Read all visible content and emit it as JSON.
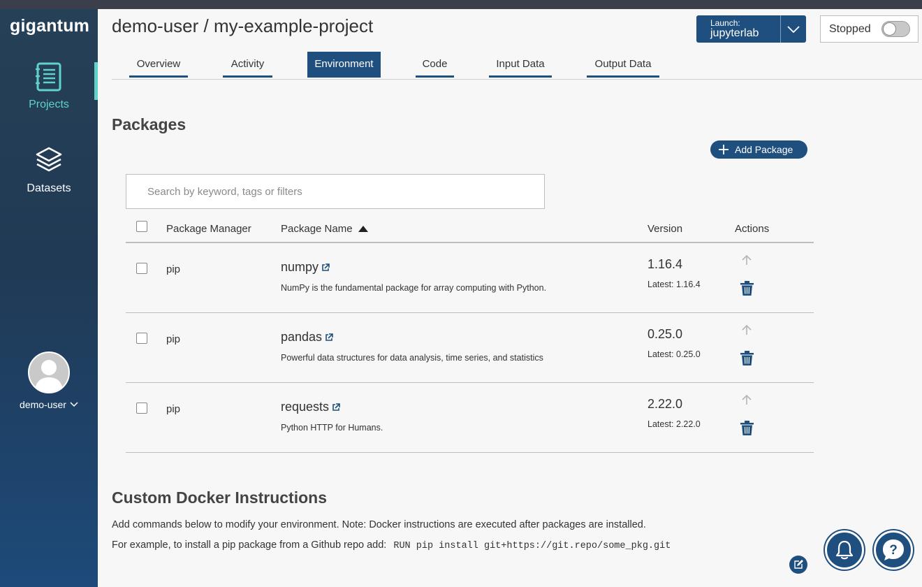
{
  "app": {
    "logo": "gigantum"
  },
  "sidebar": {
    "items": [
      {
        "label": "Projects",
        "icon": "notebook-icon",
        "active": true
      },
      {
        "label": "Datasets",
        "icon": "layers-icon",
        "active": false
      }
    ],
    "user": {
      "name": "demo-user"
    },
    "active_color": "#60d2c9"
  },
  "header": {
    "project_title": "demo-user / my-example-project",
    "launch": {
      "caption": "Launch:",
      "tool": "jupyterlab"
    },
    "status": {
      "label": "Stopped",
      "running": false
    }
  },
  "tabs": [
    {
      "label": "Overview",
      "active": false
    },
    {
      "label": "Activity",
      "active": false
    },
    {
      "label": "Environment",
      "active": true
    },
    {
      "label": "Code",
      "active": false
    },
    {
      "label": "Input Data",
      "active": false
    },
    {
      "label": "Output Data",
      "active": false
    }
  ],
  "packages": {
    "heading": "Packages",
    "add_button": "Add Package",
    "search_placeholder": "Search by keyword, tags or filters",
    "columns": {
      "manager": "Package Manager",
      "name": "Package Name",
      "version": "Version",
      "actions": "Actions"
    },
    "rows": [
      {
        "manager": "pip",
        "name": "numpy",
        "description": "NumPy is the fundamental package for array computing with Python.",
        "version": "1.16.4",
        "latest": "Latest: 1.16.4"
      },
      {
        "manager": "pip",
        "name": "pandas",
        "description": "Powerful data structures for data analysis, time series, and statistics",
        "version": "0.25.0",
        "latest": "Latest: 0.25.0"
      },
      {
        "manager": "pip",
        "name": "requests",
        "description": "Python HTTP for Humans.",
        "version": "2.22.0",
        "latest": "Latest: 2.22.0"
      }
    ]
  },
  "docker": {
    "heading": "Custom Docker Instructions",
    "line1": "Add commands below to modify your environment. Note: Docker instructions are executed after packages are installed.",
    "line2": "For example, to install a pip package from a Github repo add:",
    "code": "RUN pip install git+https://git.repo/some_pkg.git"
  },
  "colors": {
    "primary": "#1f4f7f",
    "sidebar": "#264057",
    "accent": "#60d2c9"
  }
}
